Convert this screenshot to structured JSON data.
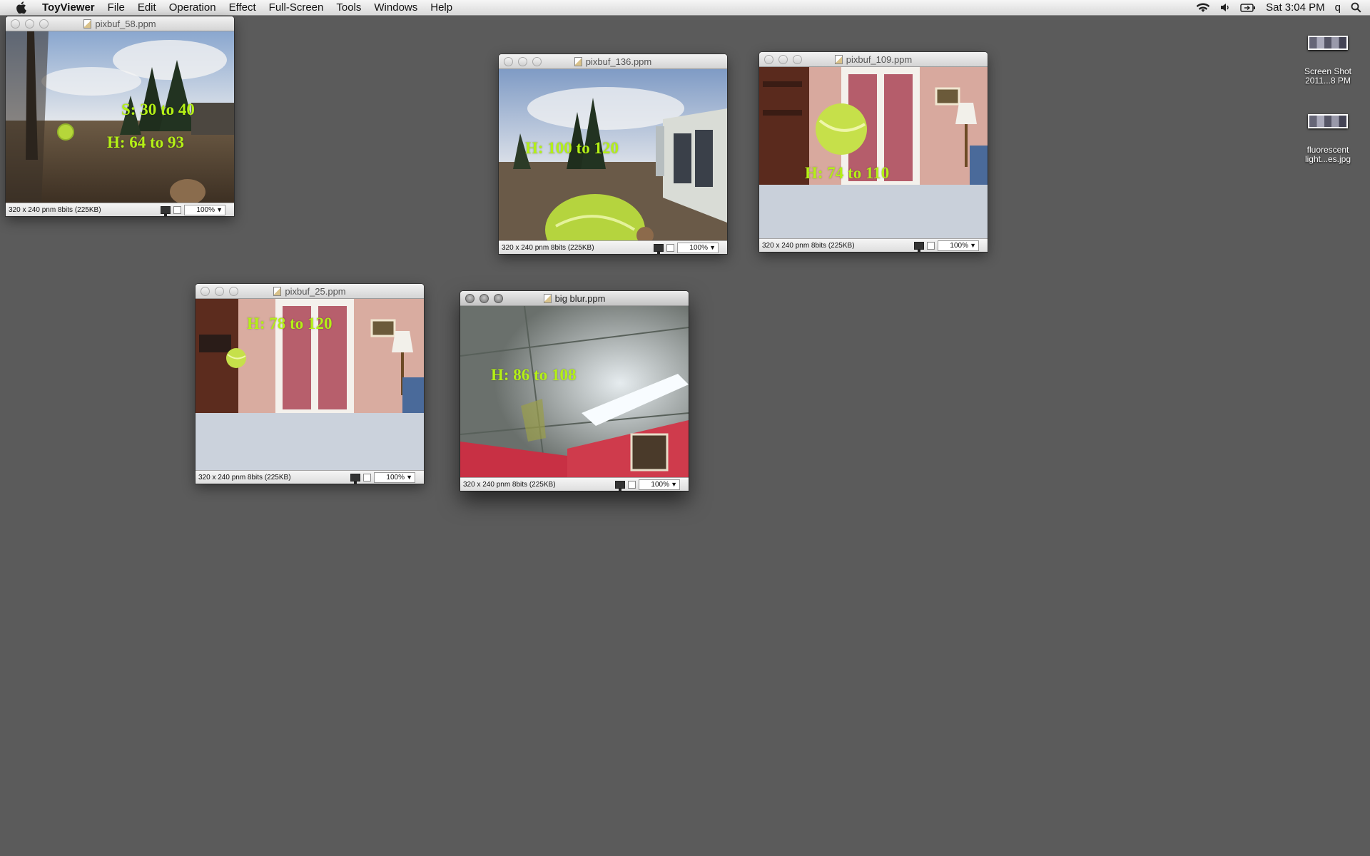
{
  "menubar": {
    "app_name": "ToyViewer",
    "items": [
      "File",
      "Edit",
      "Operation",
      "Effect",
      "Full-Screen",
      "Tools",
      "Windows",
      "Help"
    ],
    "clock": "Sat 3:04 PM",
    "user": "q"
  },
  "windows": [
    {
      "title": "pixbuf_58.ppm",
      "status": "320 x 240  pnm  8bits (225KB)",
      "zoom": "100%",
      "labels": [
        "S: 30 to 40",
        "H: 64 to 93"
      ]
    },
    {
      "title": "pixbuf_136.ppm",
      "status": "320 x 240  pnm  8bits (225KB)",
      "zoom": "100%",
      "labels": [
        "H: 100 to 120"
      ]
    },
    {
      "title": "pixbuf_109.ppm",
      "status": "320 x 240  pnm  8bits (225KB)",
      "zoom": "100%",
      "labels": [
        "H: 74 to 110"
      ]
    },
    {
      "title": "pixbuf_25.ppm",
      "status": "320 x 240  pnm  8bits (225KB)",
      "zoom": "100%",
      "labels": [
        "H: 78 to 120"
      ]
    },
    {
      "title": "big blur.ppm",
      "status": "320 x 240  pnm  8bits (225KB)",
      "zoom": "100%",
      "labels": [
        "H: 86 to 108"
      ]
    }
  ],
  "desktop_icons": [
    {
      "line1": "Screen Shot",
      "line2": "2011...8 PM"
    },
    {
      "line1": "fluorescent",
      "line2": "light...es.jpg"
    }
  ],
  "colors": {
    "desktop": "#5b5b5b",
    "label_green": "#b4f016"
  }
}
